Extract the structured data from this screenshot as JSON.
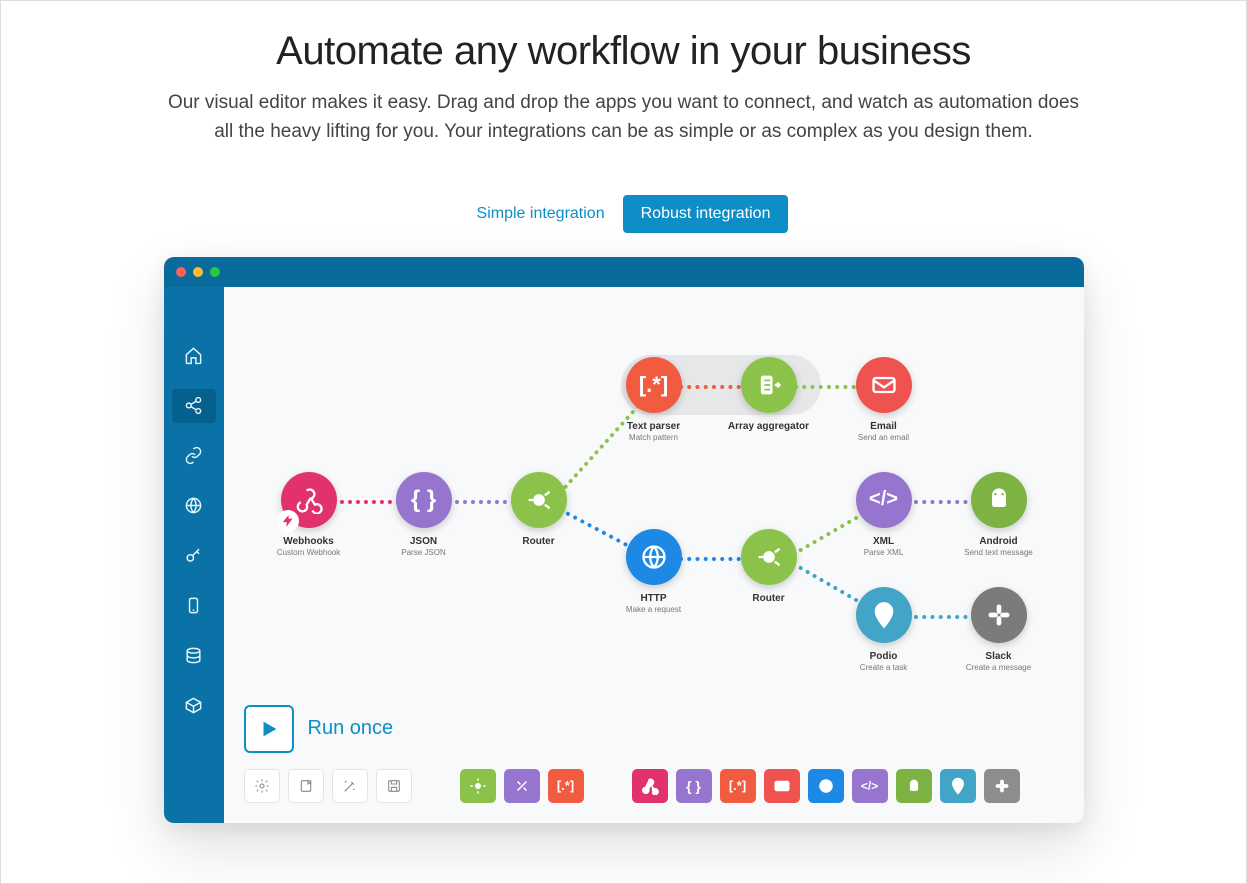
{
  "header": {
    "title": "Automate any workflow in your business",
    "subtitle": "Our visual editor makes it easy. Drag and drop the apps you want to connect, and watch as automation does all the heavy lifting for you. Your integrations can be as simple or as complex as you design them."
  },
  "tabs": {
    "simple": "Simple integration",
    "robust": "Robust integration"
  },
  "editor": {
    "run_label": "Run once",
    "sidebar_icons": [
      "home",
      "share",
      "link",
      "globe",
      "key",
      "phone",
      "database",
      "box"
    ],
    "nodes": {
      "webhooks": {
        "title": "Webhooks",
        "sub": "Custom Webhook"
      },
      "json": {
        "title": "JSON",
        "sub": "Parse JSON"
      },
      "router1": {
        "title": "Router",
        "sub": ""
      },
      "textparser": {
        "title": "Text parser",
        "sub": "Match pattern"
      },
      "arrayagg": {
        "title": "Array aggregator",
        "sub": ""
      },
      "email": {
        "title": "Email",
        "sub": "Send an email"
      },
      "http": {
        "title": "HTTP",
        "sub": "Make a request"
      },
      "router2": {
        "title": "Router",
        "sub": ""
      },
      "xml": {
        "title": "XML",
        "sub": "Parse XML"
      },
      "android": {
        "title": "Android",
        "sub": "Send text message"
      },
      "podio": {
        "title": "Podio",
        "sub": "Create a task"
      },
      "slack": {
        "title": "Slack",
        "sub": "Create a message"
      }
    },
    "bottom_gray_tools": [
      "gear",
      "note",
      "wand",
      "save"
    ],
    "bottom_color_tools": [
      {
        "name": "gear",
        "color": "#8bc34a"
      },
      {
        "name": "tools",
        "color": "#9575cd"
      },
      {
        "name": "brackets",
        "color": "#f15b40"
      }
    ],
    "bottom_app_icons": [
      {
        "name": "webhook",
        "color": "#e2316f"
      },
      {
        "name": "json",
        "color": "#9575cd"
      },
      {
        "name": "brackets",
        "color": "#f15b40"
      },
      {
        "name": "mail",
        "color": "#ef5350"
      },
      {
        "name": "globe",
        "color": "#1e88e5"
      },
      {
        "name": "code",
        "color": "#9575cd"
      },
      {
        "name": "android",
        "color": "#7cb342"
      },
      {
        "name": "pin",
        "color": "#42a5c7"
      },
      {
        "name": "slack",
        "color": "#7b7b7b"
      }
    ]
  }
}
